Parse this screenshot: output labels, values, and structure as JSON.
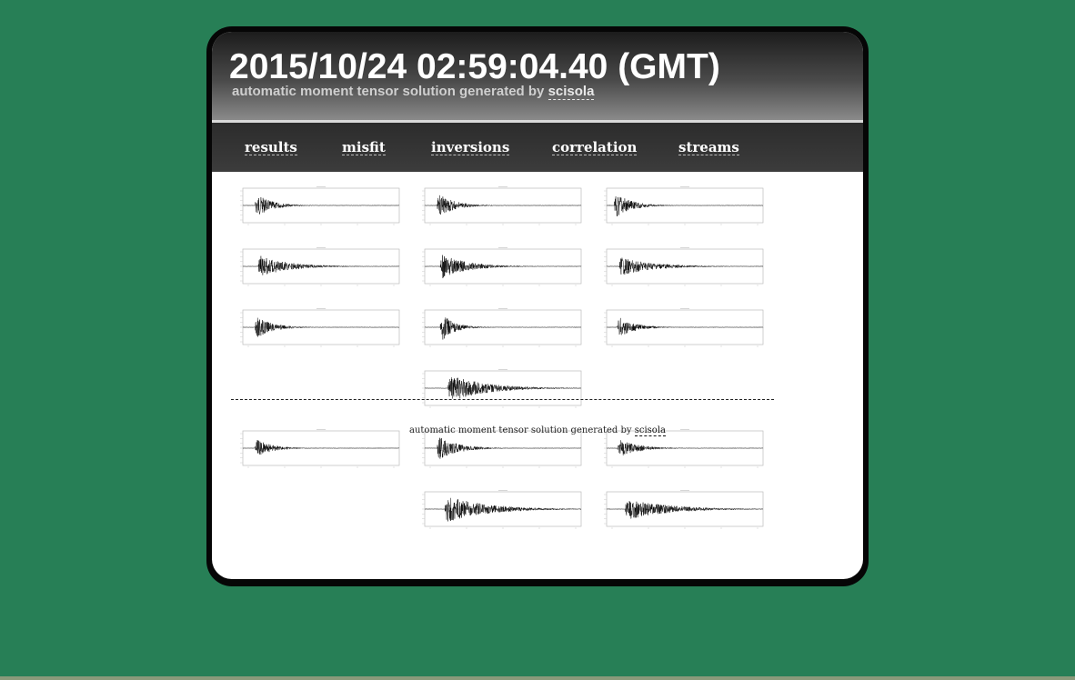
{
  "header": {
    "title": "2015/10/24 02:59:04.40 (GMT)",
    "subtitle_prefix": "automatic moment tensor solution generated by ",
    "subtitle_link": "scisola"
  },
  "nav": {
    "items": [
      {
        "label": "results"
      },
      {
        "label": "misfit"
      },
      {
        "label": "inversions"
      },
      {
        "label": "correlation"
      },
      {
        "label": "streams"
      }
    ]
  },
  "footer": {
    "text_prefix": "automatic moment tensor solution generated by ",
    "link": "scisola"
  },
  "colors": {
    "background": "#277f56",
    "frame": "#060606",
    "header_text": "#ffffff"
  },
  "stream_plots": [
    {
      "row": 1,
      "col": 1,
      "onset": 0.08,
      "amplitude": 0.75,
      "decay": 0.1
    },
    {
      "row": 1,
      "col": 2,
      "onset": 0.08,
      "amplitude": 0.8,
      "decay": 0.1
    },
    {
      "row": 1,
      "col": 3,
      "onset": 0.05,
      "amplitude": 0.85,
      "decay": 0.1
    },
    {
      "row": 2,
      "col": 1,
      "onset": 0.1,
      "amplitude": 0.7,
      "decay": 0.18
    },
    {
      "row": 2,
      "col": 2,
      "onset": 0.1,
      "amplitude": 0.8,
      "decay": 0.16
    },
    {
      "row": 2,
      "col": 3,
      "onset": 0.08,
      "amplitude": 0.6,
      "decay": 0.2
    },
    {
      "row": 3,
      "col": 1,
      "onset": 0.08,
      "amplitude": 0.75,
      "decay": 0.1
    },
    {
      "row": 3,
      "col": 2,
      "onset": 0.1,
      "amplitude": 0.95,
      "decay": 0.08
    },
    {
      "row": 3,
      "col": 3,
      "onset": 0.07,
      "amplitude": 0.7,
      "decay": 0.1
    },
    {
      "row": 4,
      "col": 2,
      "onset": 0.15,
      "amplitude": 0.9,
      "decay": 0.22
    },
    {
      "row": 5,
      "col": 1,
      "onset": 0.08,
      "amplitude": 0.6,
      "decay": 0.1
    },
    {
      "row": 5,
      "col": 2,
      "onset": 0.08,
      "amplitude": 0.8,
      "decay": 0.12
    },
    {
      "row": 5,
      "col": 3,
      "onset": 0.07,
      "amplitude": 0.6,
      "decay": 0.12
    },
    {
      "row": 6,
      "col": 2,
      "onset": 0.13,
      "amplitude": 0.85,
      "decay": 0.25
    },
    {
      "row": 6,
      "col": 3,
      "onset": 0.12,
      "amplitude": 0.7,
      "decay": 0.25
    }
  ]
}
